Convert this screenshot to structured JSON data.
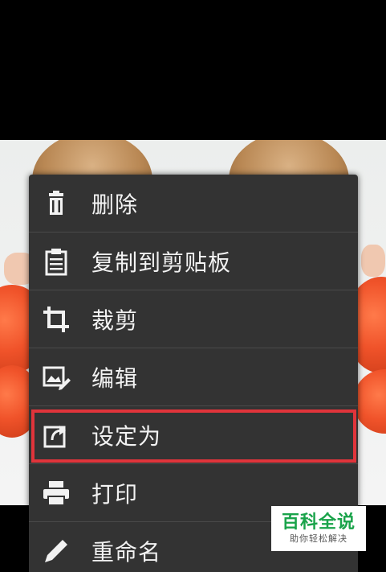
{
  "menu": {
    "items": [
      {
        "label": "删除",
        "icon": "trash-icon"
      },
      {
        "label": "复制到剪贴板",
        "icon": "clipboard-icon"
      },
      {
        "label": "裁剪",
        "icon": "crop-icon"
      },
      {
        "label": "编辑",
        "icon": "edit-image-icon"
      },
      {
        "label": "设定为",
        "icon": "set-as-icon",
        "highlighted": true
      },
      {
        "label": "打印",
        "icon": "printer-icon"
      },
      {
        "label": "重命名",
        "icon": "pencil-icon"
      }
    ]
  },
  "watermark": {
    "title": "百科全说",
    "subtitle": "助你轻松解决"
  },
  "colors": {
    "menu_background": "#333333",
    "highlight_border": "#e0343b",
    "watermark_green": "#19a34a"
  }
}
